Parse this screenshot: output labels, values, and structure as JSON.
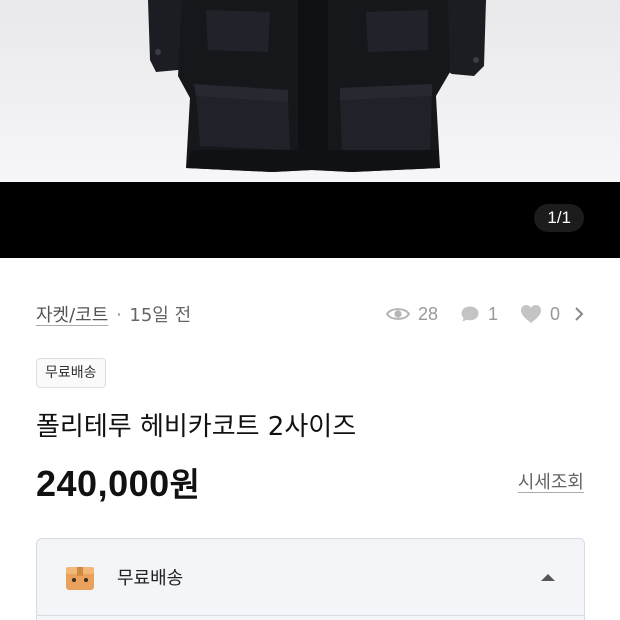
{
  "gallery": {
    "pager": "1/1"
  },
  "meta": {
    "category": "자켓/코트",
    "separator": "·",
    "time": "15일 전",
    "views": "28",
    "chats": "1",
    "likes": "0"
  },
  "badge": "무료배송",
  "product": {
    "title": "폴리테루 헤비카코트 2사이즈",
    "price": "240,000",
    "price_unit": "원",
    "market_link": "시세조회"
  },
  "shipping": {
    "label": "무료배송"
  },
  "colors": {
    "icon_gray": "#b5b5b5",
    "box_orange": "#e9a15b"
  }
}
